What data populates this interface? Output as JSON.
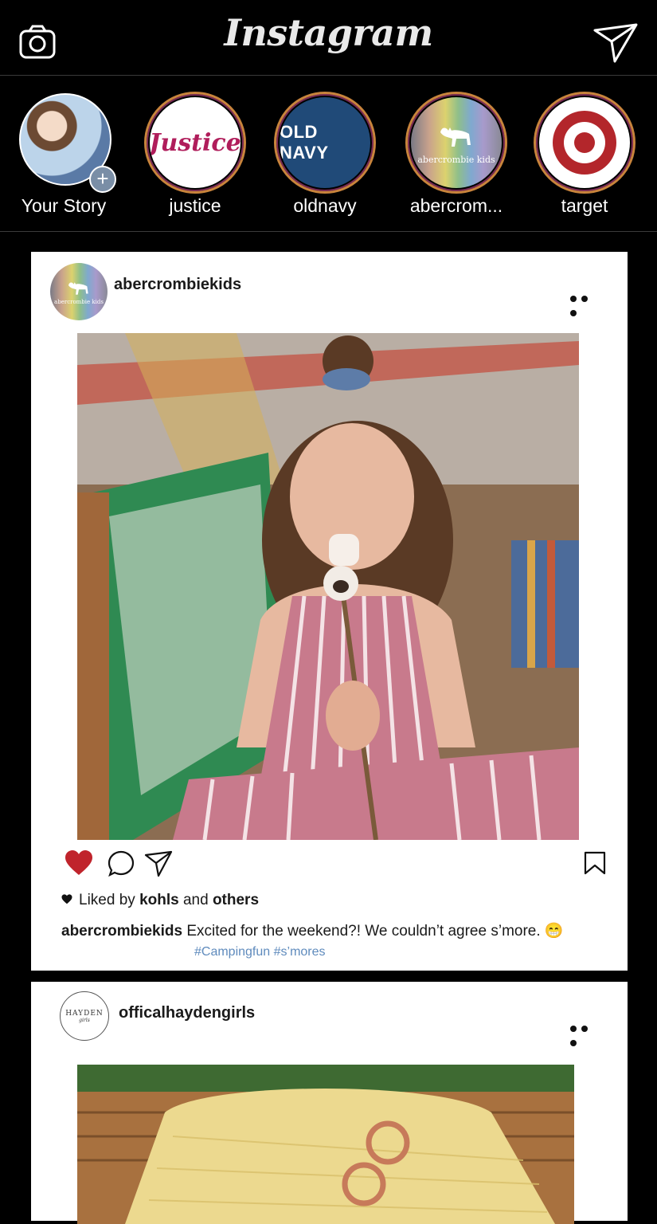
{
  "header": {
    "brand": "Instagram",
    "camera_icon": "camera-icon",
    "send_icon": "paper-plane-icon"
  },
  "stories": [
    {
      "name": "Your Story",
      "avatar": "own-profile-photo",
      "add_icon": "+"
    },
    {
      "name": "justice",
      "avatar_text": "Justice"
    },
    {
      "name": "oldnavy",
      "avatar_text": "OLD NAVY"
    },
    {
      "name": "abercrom...",
      "avatar_text": "abercrombie kids"
    },
    {
      "name": "target",
      "avatar": "target-logo"
    }
  ],
  "posts": [
    {
      "username": "abercrombiekids",
      "avatar_text": "abercrombie kids",
      "liked_prefix": "Liked by",
      "liked_user": "kohls",
      "liked_and": "and",
      "liked_others": "others",
      "caption_user": "abercrombiekids",
      "caption_text": "Excited for the weekend?! We couldn’t agree s’more. 😁",
      "hashtags": "#Campingfun #s’mores",
      "liked": true
    },
    {
      "username": "officalhaydengirls",
      "avatar_text_1": "HAYDEN",
      "avatar_text_2": "girls"
    }
  ],
  "colors": {
    "background": "#000000",
    "card": "#ffffff",
    "like_red": "#c0242c",
    "hashtag": "#5f8bbd",
    "story_ring": "#c8843c"
  }
}
